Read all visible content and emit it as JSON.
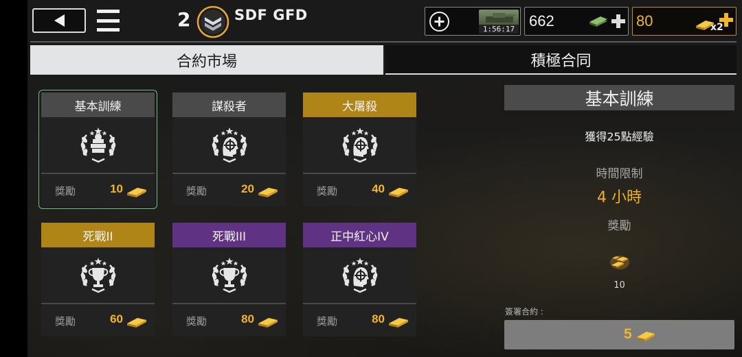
{
  "header": {
    "rank": "2",
    "player_name": "SDF GFD",
    "timer": "1:56:17",
    "cash": "662",
    "gold": "80",
    "gold_multiplier": "x2"
  },
  "tabs": [
    {
      "label": "合約市場",
      "active": true
    },
    {
      "label": "積極合同",
      "active": false
    }
  ],
  "contracts": [
    {
      "title": "基本訓練",
      "color": "grey",
      "icon": "money-stack-icon",
      "reward_label": "獎勵",
      "reward": "10",
      "selected": true
    },
    {
      "title": "謀殺者",
      "color": "grey",
      "icon": "crosshair-head-icon",
      "reward_label": "獎勵",
      "reward": "20",
      "selected": false
    },
    {
      "title": "大屠殺",
      "color": "gold",
      "icon": "crosshair-head-icon",
      "reward_label": "獎勵",
      "reward": "40",
      "selected": false
    },
    {
      "title": "死戰II",
      "color": "gold",
      "icon": "trophy-icon",
      "reward_label": "獎勵",
      "reward": "60",
      "selected": false
    },
    {
      "title": "死戰III",
      "color": "purple",
      "icon": "trophy-icon",
      "reward_label": "獎勵",
      "reward": "80",
      "selected": false
    },
    {
      "title": "正中紅心IV",
      "color": "purple",
      "icon": "crosshair-head-icon",
      "reward_label": "獎勵",
      "reward": "80",
      "selected": false
    }
  ],
  "detail": {
    "title": "基本訓練",
    "description": "獲得25點經驗",
    "time_label": "時間限制",
    "time_value": "4 小時",
    "reward_label": "獎勵",
    "reward_value": "10",
    "sign_label": "簽署合約 :",
    "sign_cost": "5"
  },
  "colors": {
    "accent_gold": "#f3b52a",
    "tier_grey": "#4a4a4a",
    "tier_gold": "#b08517",
    "tier_purple": "#5f3283",
    "selected_outline": "#6dbf8e"
  }
}
